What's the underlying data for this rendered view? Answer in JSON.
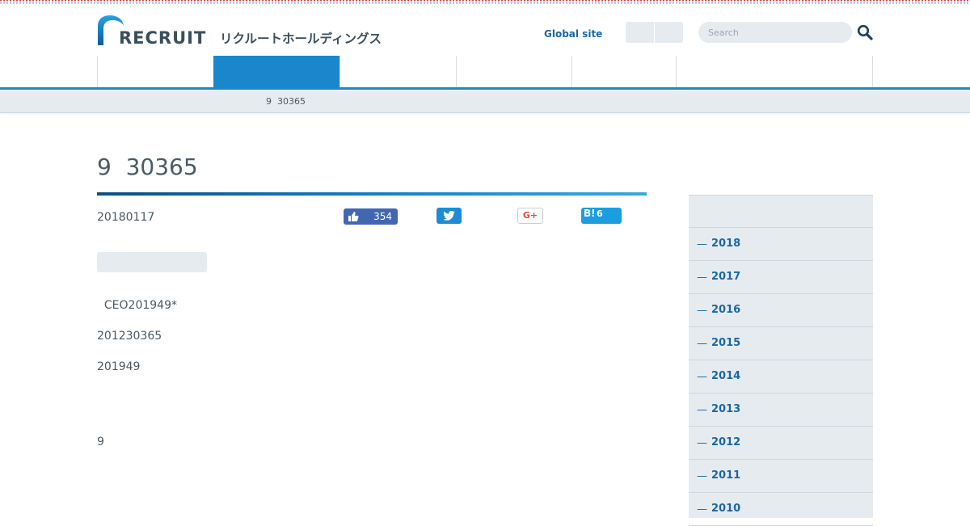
{
  "header": {
    "logo_text": "RECRUIT",
    "logo_katakana": "リクルートホールディングス",
    "global_site_label": "Global site",
    "search_placeholder": "Search"
  },
  "nav": {
    "items": [
      "",
      "",
      "",
      "",
      "",
      ""
    ],
    "active_index": 1
  },
  "breadcrumb": {
    "current": "9  30365"
  },
  "article": {
    "title": "9  30365",
    "date": "20180117",
    "share": {
      "facebook_count": "354",
      "hatena_logo": "B!",
      "hatena_count": "6",
      "google_plus_label": "G+"
    },
    "paragraphs": [
      "  CEO201949*",
      "201230365",
      "201949",
      "9"
    ]
  },
  "sidebar": {
    "years": [
      "2018",
      "2017",
      "2016",
      "2015",
      "2014",
      "2013",
      "2012",
      "2011",
      "2010"
    ],
    "dash": "—"
  },
  "colors": {
    "accent": "#1a87c9",
    "brand_dark": "#1a67a6",
    "panel": "#e6ebef",
    "facebook": "#4267b2",
    "twitter": "#1d8bd6",
    "hatena": "#1a9ee0",
    "google_plus": "#dd4b39"
  }
}
